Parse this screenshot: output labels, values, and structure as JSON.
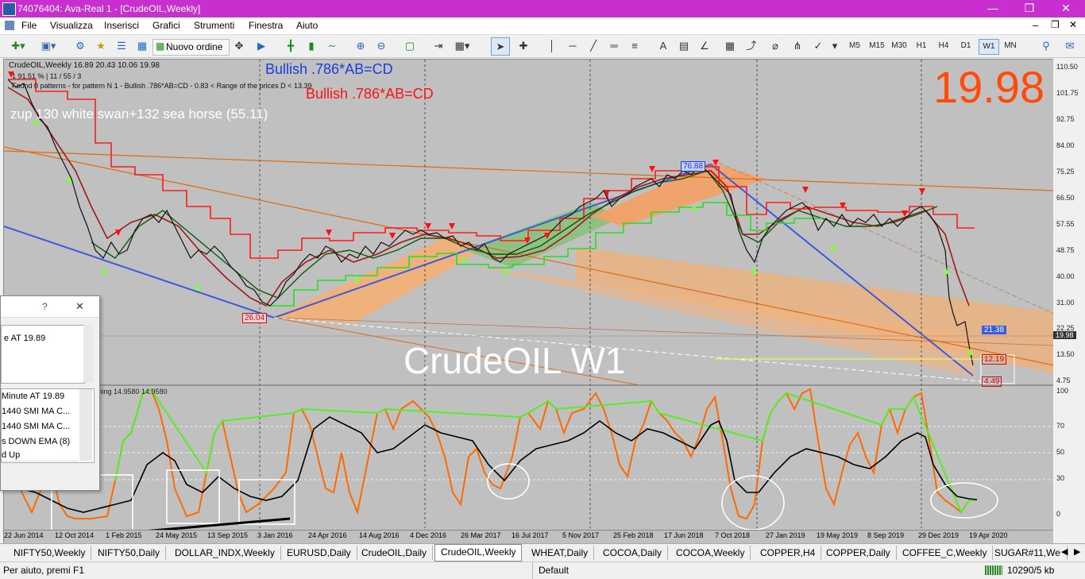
{
  "window": {
    "title": "74076404: Ava-Real 1 - [CrudeOIL,Weekly]"
  },
  "menu": [
    "File",
    "Visualizza",
    "Inserisci",
    "Grafici",
    "Strumenti",
    "Finestra",
    "Aiuto"
  ],
  "toolbar": {
    "new_order_label": "Nuovo ordine",
    "timeframes": [
      "M5",
      "M15",
      "M30",
      "H1",
      "H4",
      "D1",
      "W1",
      "MN"
    ],
    "active_timeframe": "W1"
  },
  "chart": {
    "header": "CrudeOIL,Weekly  16.89 20.43 10.06 19.98",
    "line2": "1  91.51 % | 11 / 55 / 3",
    "line3": "Found 0 patterns  -  for pattern N 1 - Bullish .786*AB=CD  - 0.83 < Range of the prices D < 13.39",
    "pattern_blue": "Bullish .786*AB=CD",
    "pattern_red": "Bullish .786*AB=CD",
    "swan_text": "zup 130 white swan+132 sea horse (55.11)",
    "big_price": "19.98",
    "watermark": "CrudeOIL W1",
    "label_high": "76.88",
    "label_low": "26.04",
    "label_2138": "21.38",
    "label_1219": "12.19",
    "label_449": "4.49",
    "current_price": "19.98",
    "osc_label": "ming 14.9580 14.9580",
    "price_axis": [
      "110.50",
      "101.75",
      "92.75",
      "84.00",
      "75.25",
      "66.50",
      "57.55",
      "48.75",
      "40.00",
      "31.00",
      "22.25",
      "13.50",
      "4.75"
    ],
    "osc_axis": [
      "100",
      "70",
      "50",
      "30",
      "0"
    ],
    "dates": [
      "22 Jun 2014",
      "12 Oct 2014",
      "1 Feb 2015",
      "24 May 2015",
      "13 Sep 2015",
      "3 Jan 2016",
      "24 Apr 2016",
      "14 Aug 2016",
      "4 Dec 2016",
      "26 Mar 2017",
      "16 Jul 2017",
      "5 Nov 2017",
      "25 Feb 2018",
      "17 Jun 2018",
      "7 Oct 2018",
      "27 Jan 2019",
      "19 May 2019",
      "8 Sep 2019",
      "29 Dec 2019",
      "19 Apr 2020"
    ]
  },
  "dialog": {
    "help": "?",
    "close": "✕",
    "line1": "e  AT 19.89",
    "list": [
      "Minute  AT 19.89",
      "1440 SMI MA C...",
      "1440 SMI MA C...",
      "s DOWN EMA (8)",
      "d Up"
    ]
  },
  "tabs": [
    "NIFTY50,Weekly",
    "NIFTY50,Daily",
    "DOLLAR_INDX,Weekly",
    "EURUSD,Daily",
    "CrudeOIL,Daily",
    "CrudeOIL,Weekly",
    "WHEAT,Daily",
    "COCOA,Daily",
    "COCOA,Weekly",
    "COPPER,H4",
    "COPPER,Daily",
    "COFFEE_C,Weekly",
    "SUGAR#11,We"
  ],
  "active_tab": "CrudeOIL,Weekly",
  "status": {
    "help": "Per aiuto, premi F1",
    "profile": "Default",
    "traffic": "10290/5 kb"
  },
  "colors": {
    "titlebar": "#c92fce",
    "chart_bg": "#c0c0c0",
    "red_line": "#ff1a1a",
    "green_line": "#22c822",
    "orange_fill": "#f5b074",
    "blue_line": "#3c5ae0",
    "big_price": "#ff4a0a"
  }
}
